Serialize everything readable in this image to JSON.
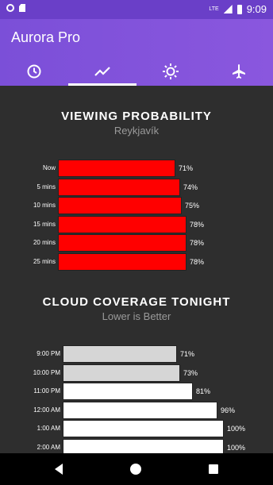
{
  "status": {
    "time": "9:09",
    "network": "LTE"
  },
  "app": {
    "title": "Aurora Pro"
  },
  "tabs": [
    {
      "icon": "clock-icon",
      "active": false
    },
    {
      "icon": "trend-icon",
      "active": true
    },
    {
      "icon": "sun-icon",
      "active": false
    },
    {
      "icon": "airplane-icon",
      "active": false
    }
  ],
  "viewing": {
    "title": "VIEWING PROBABILITY",
    "subtitle": "Reykjavík",
    "color": "#ff0000",
    "rows": [
      {
        "label": "Now",
        "value": 71,
        "text": "71%"
      },
      {
        "label": "5 mins",
        "value": 74,
        "text": "74%"
      },
      {
        "label": "10 mins",
        "value": 75,
        "text": "75%"
      },
      {
        "label": "15 mins",
        "value": 78,
        "text": "78%"
      },
      {
        "label": "20 mins",
        "value": 78,
        "text": "78%"
      },
      {
        "label": "25 mins",
        "value": 78,
        "text": "78%"
      }
    ]
  },
  "cloud": {
    "title": "CLOUD COVERAGE TONIGHT",
    "subtitle": "Lower is Better",
    "rows": [
      {
        "label": "9:00 PM",
        "value": 71,
        "text": "71%",
        "color": "#d6d6d6"
      },
      {
        "label": "10:00 PM",
        "value": 73,
        "text": "73%",
        "color": "#d6d6d6"
      },
      {
        "label": "11:00 PM",
        "value": 81,
        "text": "81%",
        "color": "#ffffff"
      },
      {
        "label": "12:00 AM",
        "value": 96,
        "text": "96%",
        "color": "#ffffff"
      },
      {
        "label": "1:00 AM",
        "value": 100,
        "text": "100%",
        "color": "#ffffff"
      },
      {
        "label": "2:00 AM",
        "value": 100,
        "text": "100%",
        "color": "#ffffff"
      }
    ]
  }
}
